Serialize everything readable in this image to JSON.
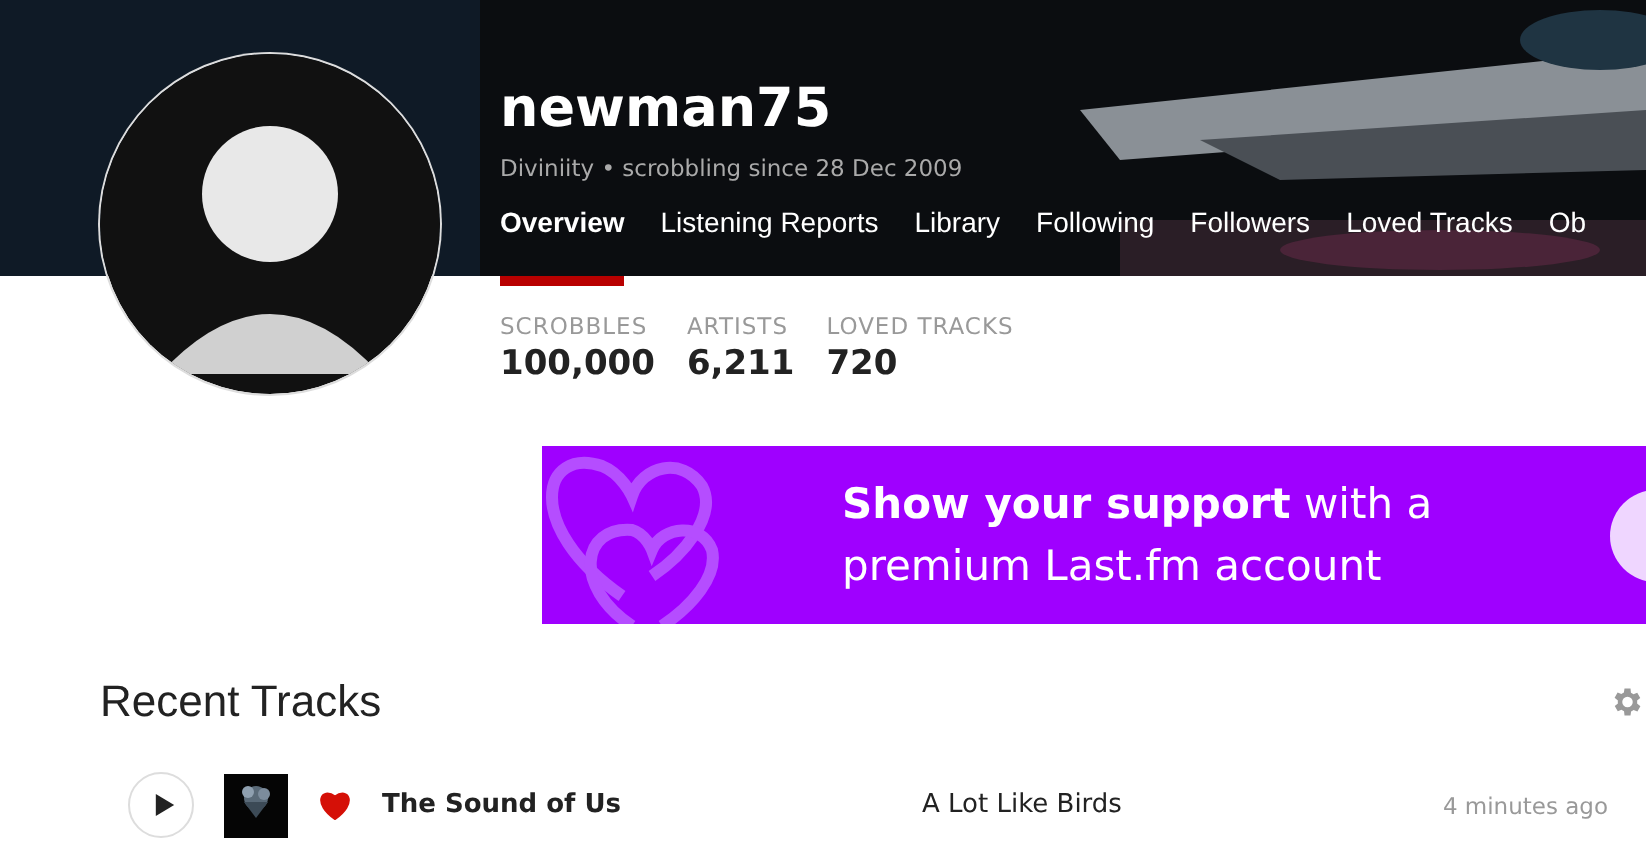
{
  "profile": {
    "username": "newman75",
    "subtitle": "Diviniity • scrobbling since 28 Dec 2009"
  },
  "tabs": [
    {
      "label": "Overview",
      "selected": true
    },
    {
      "label": "Listening Reports",
      "selected": false
    },
    {
      "label": "Library",
      "selected": false
    },
    {
      "label": "Following",
      "selected": false
    },
    {
      "label": "Followers",
      "selected": false
    },
    {
      "label": "Loved Tracks",
      "selected": false
    },
    {
      "label": "Ob",
      "selected": false
    }
  ],
  "stats": [
    {
      "label": "SCROBBLES",
      "value": "100,000"
    },
    {
      "label": "ARTISTS",
      "value": "6,211"
    },
    {
      "label": "LOVED TRACKS",
      "value": "720"
    }
  ],
  "banner": {
    "text": "**Show your support** with a premium Last.fm account"
  },
  "recent_tracks": {
    "title": "Recent Tracks",
    "rows": [
      {
        "loved": true,
        "track": "The Sound of Us",
        "artist": "A Lot Like Birds",
        "time": "4 minutes ago"
      }
    ]
  }
}
